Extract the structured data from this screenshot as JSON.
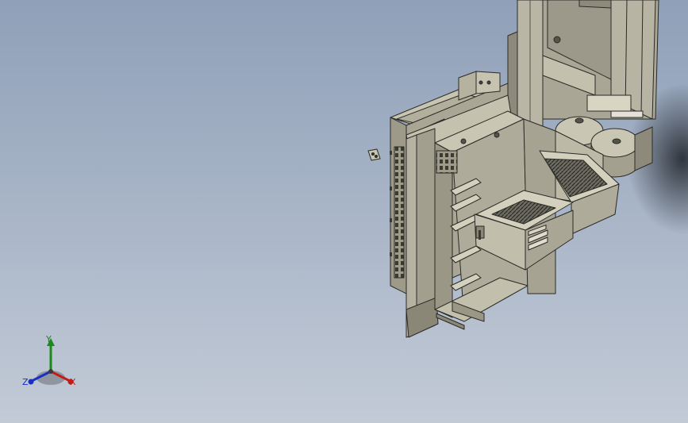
{
  "viewport": {
    "background_top": "#8fa0b8",
    "background_bottom": "#c2cad6",
    "model_fill": "#aaa796",
    "model_edge": "#2b2b27"
  },
  "triad": {
    "x_label": "X",
    "y_label": "Y",
    "z_label": "Z",
    "x_color": "#c21b1b",
    "y_color": "#1a8a1a",
    "z_color": "#1b2fc2"
  }
}
